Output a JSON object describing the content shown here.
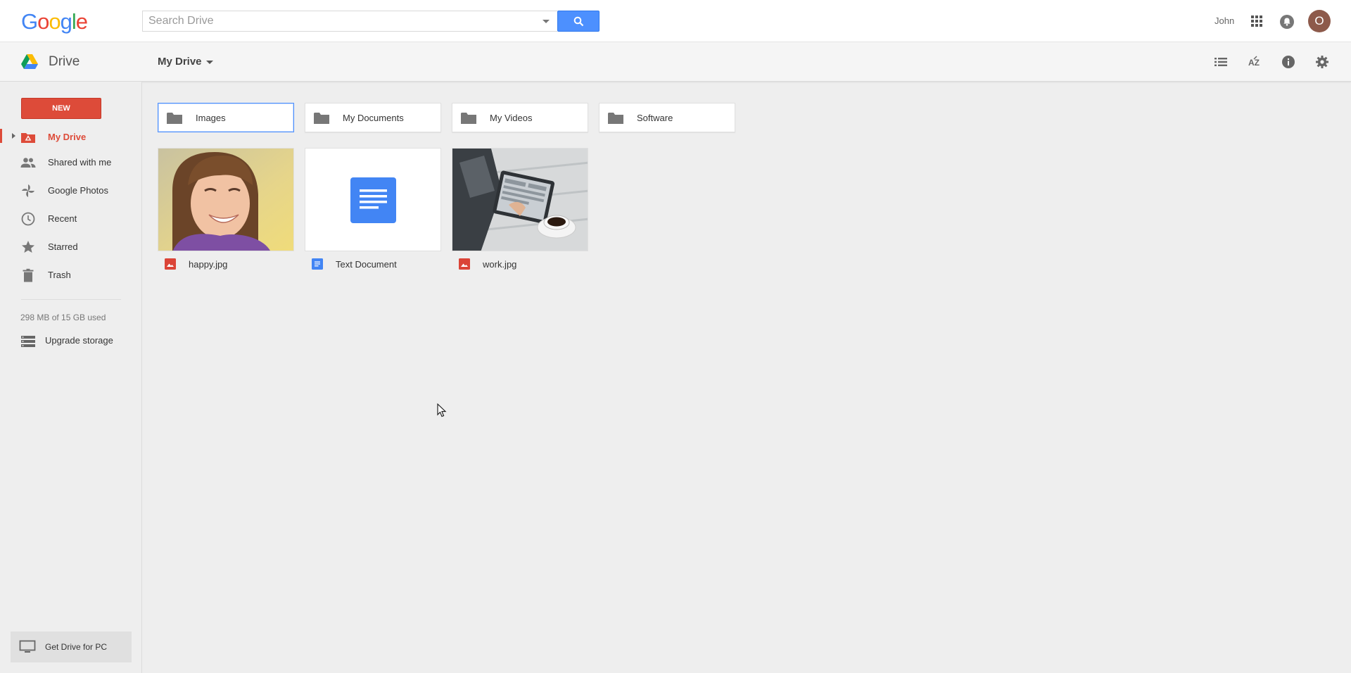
{
  "header": {
    "logo_letters": [
      "G",
      "o",
      "o",
      "g",
      "l",
      "e"
    ],
    "logo_colors": [
      "#4285f4",
      "#ea4335",
      "#fbbc05",
      "#4285f4",
      "#34a853",
      "#ea4335"
    ],
    "search_placeholder": "Search Drive",
    "user_name": "John",
    "avatar_initial": "O",
    "icons": [
      "search-icon",
      "apps-icon",
      "notifications-icon"
    ]
  },
  "drivebar": {
    "product_name": "Drive",
    "location_label": "My Drive",
    "tool_icons": [
      "list-view-icon",
      "sort-az-icon",
      "info-icon",
      "settings-icon"
    ]
  },
  "sidebar": {
    "new_button": "NEW",
    "items": [
      {
        "label": "My Drive",
        "icon": "my-drive-icon",
        "active": true
      },
      {
        "label": "Shared with me",
        "icon": "people-icon",
        "active": false
      },
      {
        "label": "Google Photos",
        "icon": "photos-pinwheel-icon",
        "active": false
      },
      {
        "label": "Recent",
        "icon": "clock-icon",
        "active": false
      },
      {
        "label": "Starred",
        "icon": "star-icon",
        "active": false
      },
      {
        "label": "Trash",
        "icon": "trash-icon",
        "active": false
      }
    ],
    "storage_text": "298 MB of 15 GB used",
    "upgrade_label": "Upgrade storage",
    "get_drive_label": "Get Drive for PC"
  },
  "main": {
    "folders": [
      {
        "name": "Images",
        "selected": true
      },
      {
        "name": "My Documents",
        "selected": false
      },
      {
        "name": "My Videos",
        "selected": false
      },
      {
        "name": "Software",
        "selected": false
      }
    ],
    "files": [
      {
        "name": "happy.jpg",
        "type": "image",
        "thumb": "photo-smiling-girl"
      },
      {
        "name": "Text Document",
        "type": "document",
        "thumb": "doc-icon"
      },
      {
        "name": "work.jpg",
        "type": "image",
        "thumb": "photo-tablet-coffee"
      }
    ]
  },
  "colors": {
    "accent_red": "#dd4b39",
    "search_blue": "#4d90fe",
    "doc_blue": "#4285f4",
    "image_red": "#db4437"
  }
}
